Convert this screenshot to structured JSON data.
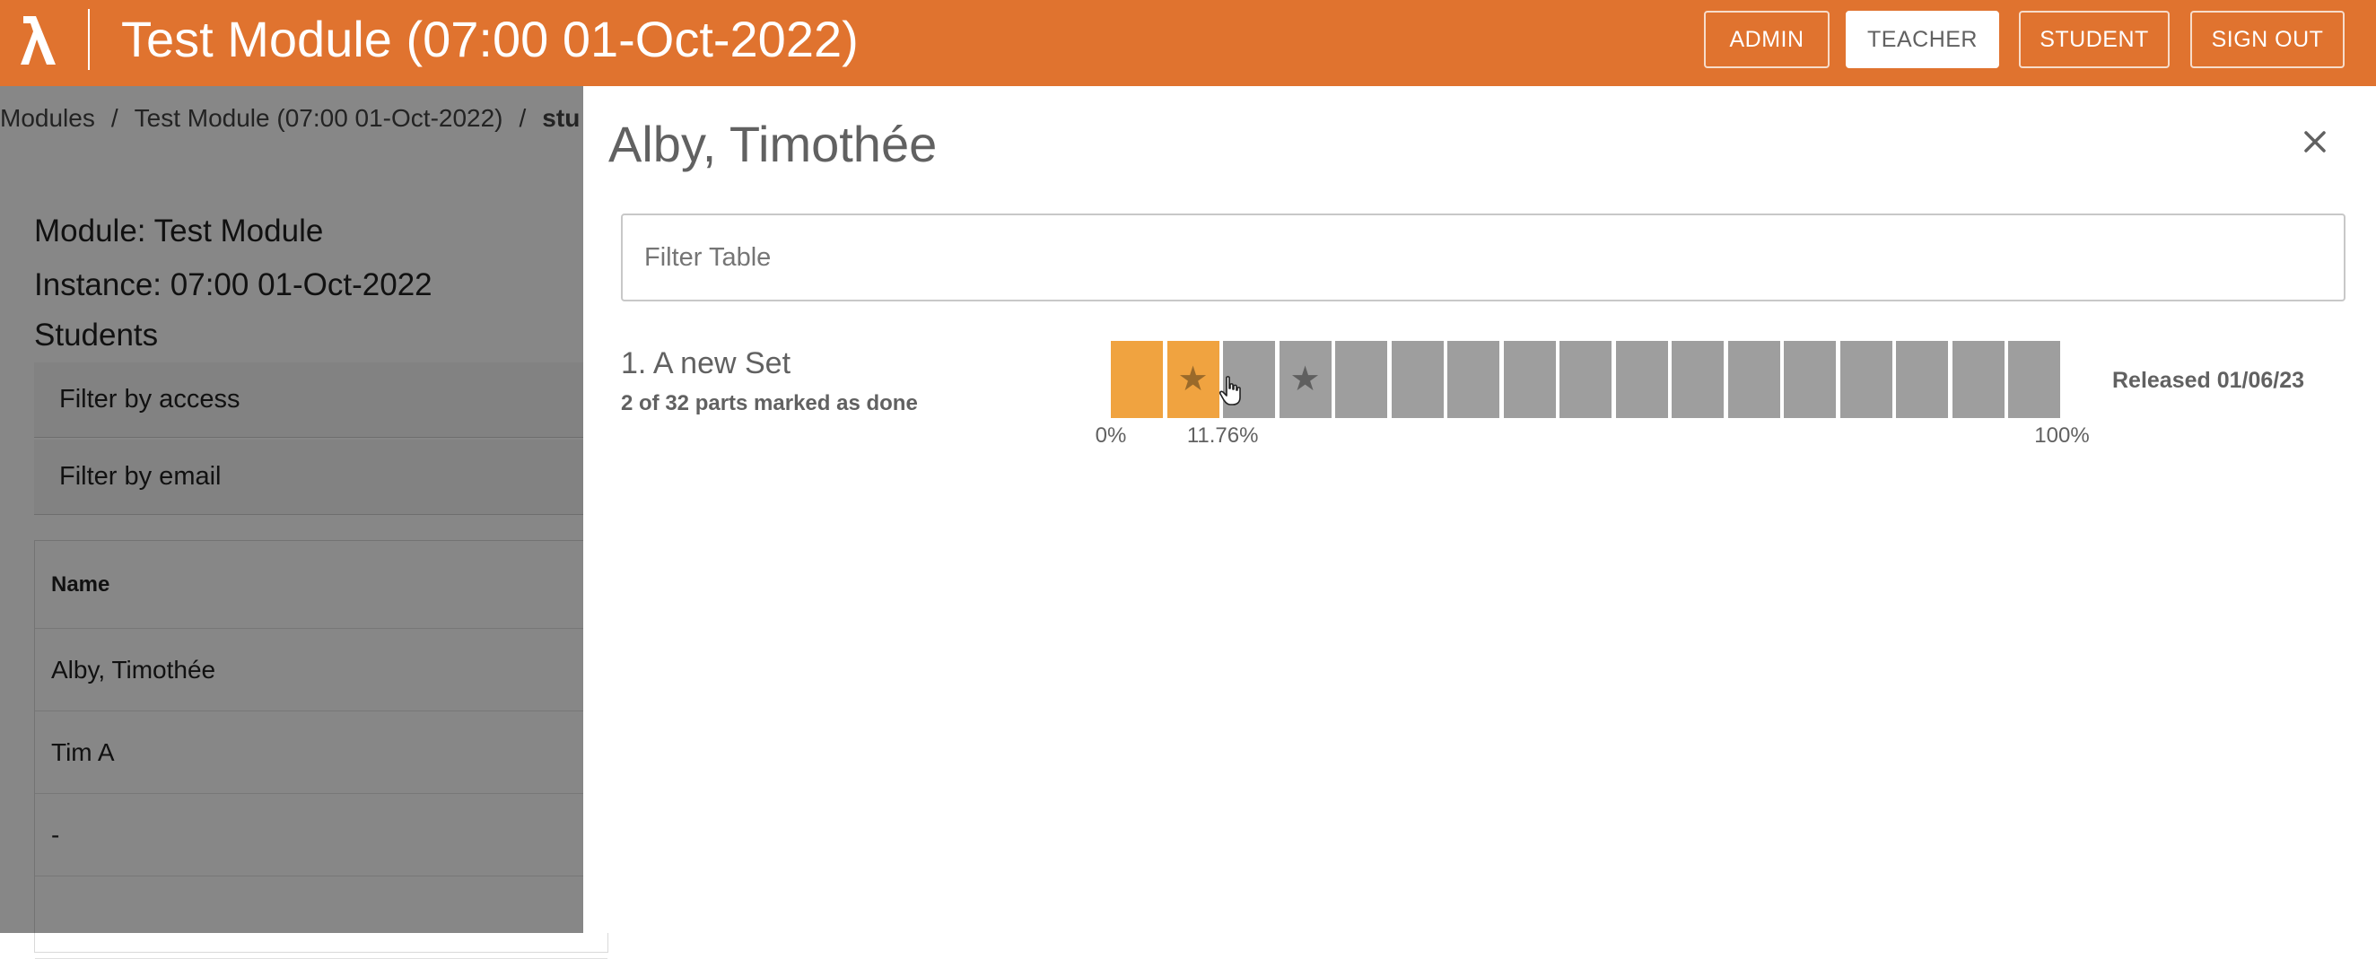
{
  "header": {
    "title": "Test Module (07:00 01-Oct-2022)",
    "nav": [
      "ADMIN",
      "TEACHER",
      "STUDENT",
      "SIGN OUT"
    ],
    "active_nav": "TEACHER",
    "accent_color": "#e0732f"
  },
  "breadcrumb": {
    "items": [
      "Modules",
      "Test Module (07:00 01-Oct-2022)",
      "stu"
    ],
    "separator": "/"
  },
  "background": {
    "module_line": "Module: Test Module",
    "instance_line": "Instance: 07:00 01-Oct-2022",
    "students_heading": "Students",
    "filter_access": "Filter by access",
    "filter_email": "Filter by email",
    "table_header": "Name",
    "rows": [
      "Alby, Timothée",
      "Tim A",
      "-"
    ]
  },
  "drawer": {
    "title": "Alby, Timothée",
    "filter_placeholder": "Filter Table",
    "set": {
      "title": "1. A new Set",
      "subtitle": "2 of 32 parts marked as done",
      "released": "Released 01/06/23",
      "segments": [
        {
          "done": true,
          "star": false
        },
        {
          "done": true,
          "star": true
        },
        {
          "done": false,
          "star": false
        },
        {
          "done": false,
          "star": true
        },
        {
          "done": false,
          "star": false
        },
        {
          "done": false,
          "star": false
        },
        {
          "done": false,
          "star": false
        },
        {
          "done": false,
          "star": false
        },
        {
          "done": false,
          "star": false
        },
        {
          "done": false,
          "star": false
        },
        {
          "done": false,
          "star": false
        },
        {
          "done": false,
          "star": false
        },
        {
          "done": false,
          "star": false
        },
        {
          "done": false,
          "star": false
        },
        {
          "done": false,
          "star": false
        },
        {
          "done": false,
          "star": false
        },
        {
          "done": false,
          "star": false
        }
      ],
      "ticks": [
        {
          "label": "0%",
          "value": 0
        },
        {
          "label": "11.76%",
          "value": 0.1176
        },
        {
          "label": "100%",
          "value": 1
        }
      ],
      "done_color": "#f0a340",
      "pending_color": "#9e9e9e"
    }
  }
}
